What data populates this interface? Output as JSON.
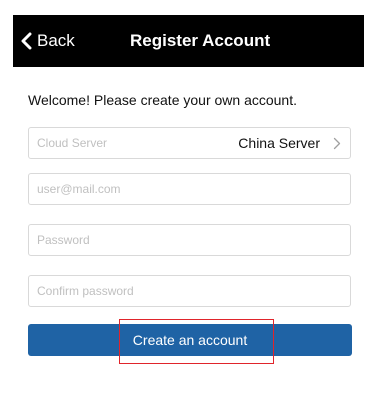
{
  "navbar": {
    "back_label": "Back",
    "title": "Register Account"
  },
  "welcome_text": "Welcome! Please create your own account.",
  "server_field": {
    "label": "Cloud Server",
    "value": "China Server",
    "icon": "chevron-right-icon"
  },
  "email_field": {
    "placeholder": "user@mail.com",
    "value": ""
  },
  "password_field": {
    "placeholder": "Password",
    "value": ""
  },
  "confirm_field": {
    "placeholder": "Confirm password",
    "value": ""
  },
  "create_button": {
    "label": "Create an account"
  },
  "colors": {
    "navbar_bg": "#000000",
    "primary": "#1f63a5",
    "highlight": "#e0242b"
  }
}
